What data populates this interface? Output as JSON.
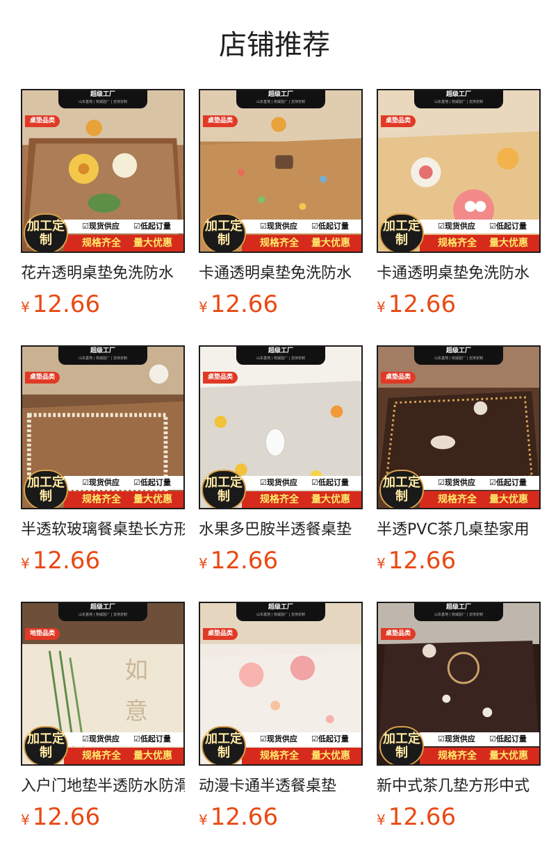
{
  "page": {
    "title": "店铺推荐"
  },
  "badge_text": {
    "brand": "超级工厂",
    "sub": "山东基地 | 权威验厂 | 支持定制",
    "circle": "加工定制",
    "check1": "☑现货供应",
    "check2": "☑低起订量",
    "promo1": "规格齐全",
    "promo2": "量大优惠"
  },
  "products": [
    {
      "name": "花卉透明桌垫免洗防水",
      "currency": "¥",
      "price": "12.66",
      "category": "桌垫品类",
      "theme": "wood-flower"
    },
    {
      "name": "卡通透明桌垫免洗防水",
      "currency": "¥",
      "price": "12.66",
      "category": "桌垫品类",
      "theme": "wood-cartoon"
    },
    {
      "name": "卡通透明桌垫免洗防水",
      "currency": "¥",
      "price": "12.66",
      "category": "桌垫品类",
      "theme": "cartoon-faces"
    },
    {
      "name": "半透软玻璃餐桌垫长方形",
      "currency": "¥",
      "price": "12.66",
      "category": "桌垫品类",
      "theme": "lace"
    },
    {
      "name": "水果多巴胺半透餐桌垫",
      "currency": "¥",
      "price": "12.66",
      "category": "桌垫品类",
      "theme": "fruit-marble"
    },
    {
      "name": "半透PVC茶几桌垫家用",
      "currency": "¥",
      "price": "12.66",
      "category": "桌垫品类",
      "theme": "tea-table"
    },
    {
      "name": "入户门地垫半透防水防滑",
      "currency": "¥",
      "price": "12.66",
      "category": "地垫品类",
      "theme": "bamboo-floor"
    },
    {
      "name": "动漫卡通半透餐桌垫",
      "currency": "¥",
      "price": "12.66",
      "category": "桌垫品类",
      "theme": "pink-cartoon"
    },
    {
      "name": "新中式茶几垫方形中式",
      "currency": "¥",
      "price": "12.66",
      "category": "桌垫品类",
      "theme": "chinese-square"
    }
  ]
}
